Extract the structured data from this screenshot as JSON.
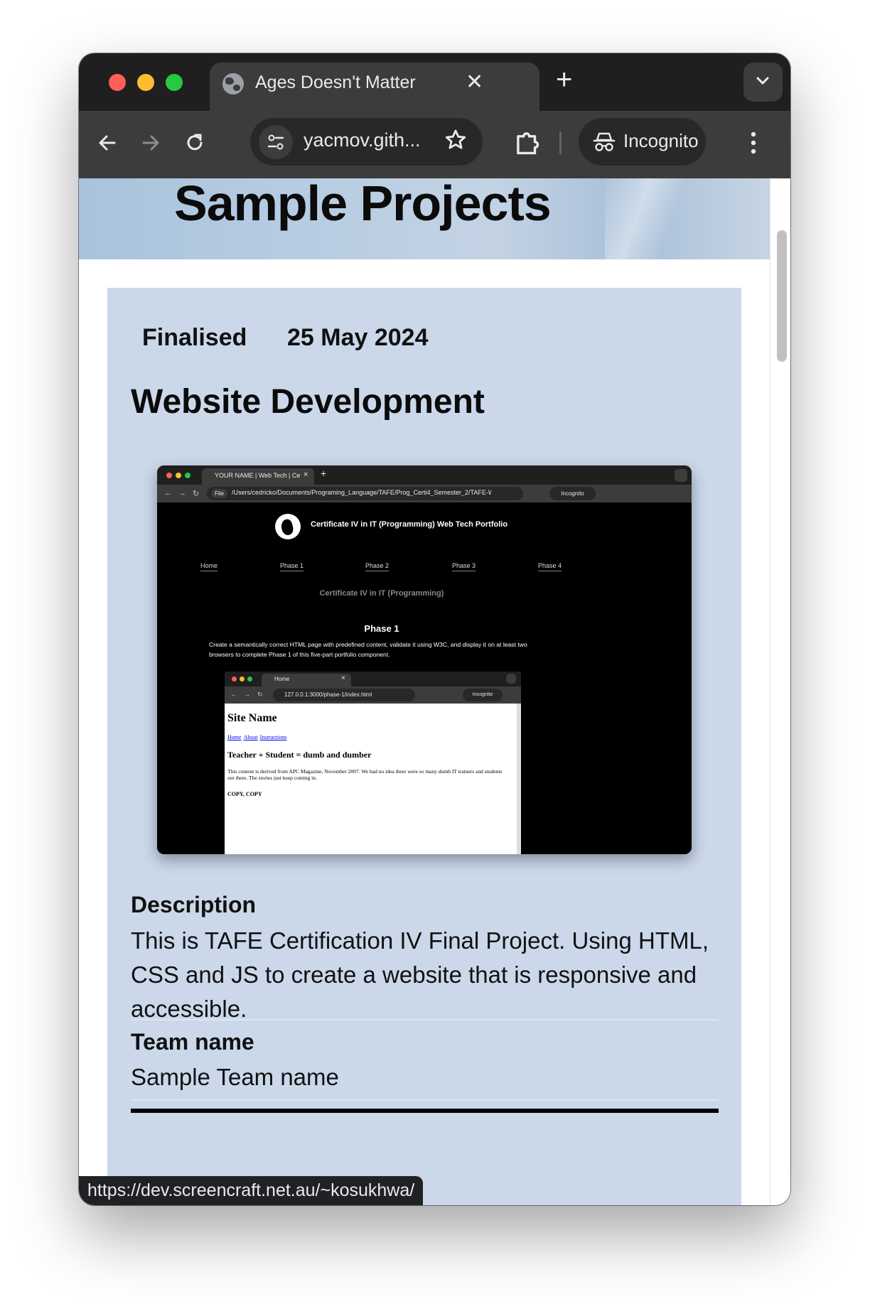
{
  "browser": {
    "tab_title": "Ages Doesn't Matter",
    "tab_close": "✕",
    "new_tab": "+",
    "url": "yacmov.gith...",
    "incognito_label": "Incognito",
    "status_url": "https://dev.screencraft.net.au/~kosukhwa/"
  },
  "page": {
    "banner_title": "Sample Projects",
    "project": {
      "status": "Finalised",
      "date": "25 May 2024",
      "title": "Website Development",
      "description_heading": "Description",
      "description": "This is TAFE Certification IV Final Project. Using HTML, CSS and JS to create a website that is responsive and accessible.",
      "team_heading": "Team name",
      "team_value": "Sample Team name"
    }
  },
  "preview": {
    "tab_title": "YOUR NAME | Web Tech | Ce",
    "file_chip": "File",
    "path": "/Users/cedricko/Documents/Programing_Language/TAFE/Prog_Certi4_Semester_2/TAFE-Web...",
    "incognito": "Incognito",
    "site_title": "Certificate IV in IT (Programming) Web Tech Portfolio",
    "nav": [
      "Home",
      "Phase 1",
      "Phase 2",
      "Phase 3",
      "Phase 4"
    ],
    "subtitle": "Certificate IV in IT (Programming)",
    "phase_heading": "Phase 1",
    "phase_text": "Create a semantically correct HTML page with predefined content, validate it using W3C, and display it on at least two browsers to complete Phase 1 of this five-part portfolio component.",
    "inner": {
      "tab_title": "Home",
      "url": "127.0.0.1:3000/phase-1/index.html",
      "incognito": "Incognito",
      "site_name": "Site Name",
      "links": [
        "Home",
        "About",
        "Instructions"
      ],
      "heading": "Teacher + Student = dumb and dumber",
      "paragraph": "This content is derived from APC Magazine, November 2007. We had no idea there were so many dumb IT trainers and students out there. The stories just keep coming in.",
      "cut_text": "COPY, COPY"
    }
  },
  "icons": {
    "tab": "globe-icon",
    "tab_search": "chevron-down-icon",
    "back": "arrow-left-icon",
    "forward": "arrow-right-icon",
    "reload": "reload-icon",
    "site_info": "tune-icon",
    "bookmark": "star-icon",
    "extensions": "puzzle-icon",
    "incognito": "incognito-icon",
    "menu": "kebab-icon"
  },
  "colors": {
    "card_bg": "#cad8ea",
    "tab_strip": "#1f1f1f",
    "toolbar": "#3c3c3c"
  }
}
